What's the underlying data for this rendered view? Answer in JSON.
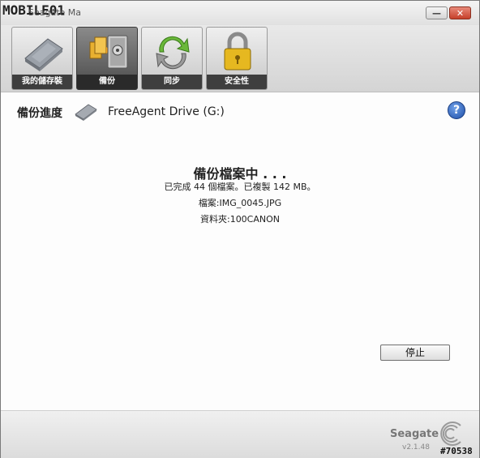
{
  "titlebar": {
    "watermark": "MOBILE01",
    "app_title": "Seagate Ma",
    "minimize_label": "—",
    "close_label": "✕"
  },
  "toolbar": {
    "items": [
      {
        "label": "我的儲存裝",
        "icon": "drive-icon",
        "active": false
      },
      {
        "label": "備份",
        "icon": "backup-safe-icon",
        "active": true
      },
      {
        "label": "同步",
        "icon": "sync-arrows-icon",
        "active": false
      },
      {
        "label": "安全性",
        "icon": "padlock-icon",
        "active": false
      }
    ]
  },
  "header": {
    "title": "備份進度",
    "drive_name": "FreeAgent Drive (G:)",
    "help_label": "?"
  },
  "status": {
    "title": "備份檔案中 . . .",
    "summary": "已完成 44 個檔案。已複製 142 MB。",
    "file": "檔案:IMG_0045.JPG",
    "folder": "資料夾:100CANON"
  },
  "actions": {
    "stop_label": "停止"
  },
  "footer": {
    "brand": "Seagate",
    "version": "v2.1.48",
    "tag": "#70538"
  },
  "colors": {
    "toolbar_label_bg": "#3e3e3e",
    "active_button_bg": "#4a4a4a",
    "close_button": "#c6402a",
    "help_icon": "#1f4fa8"
  }
}
